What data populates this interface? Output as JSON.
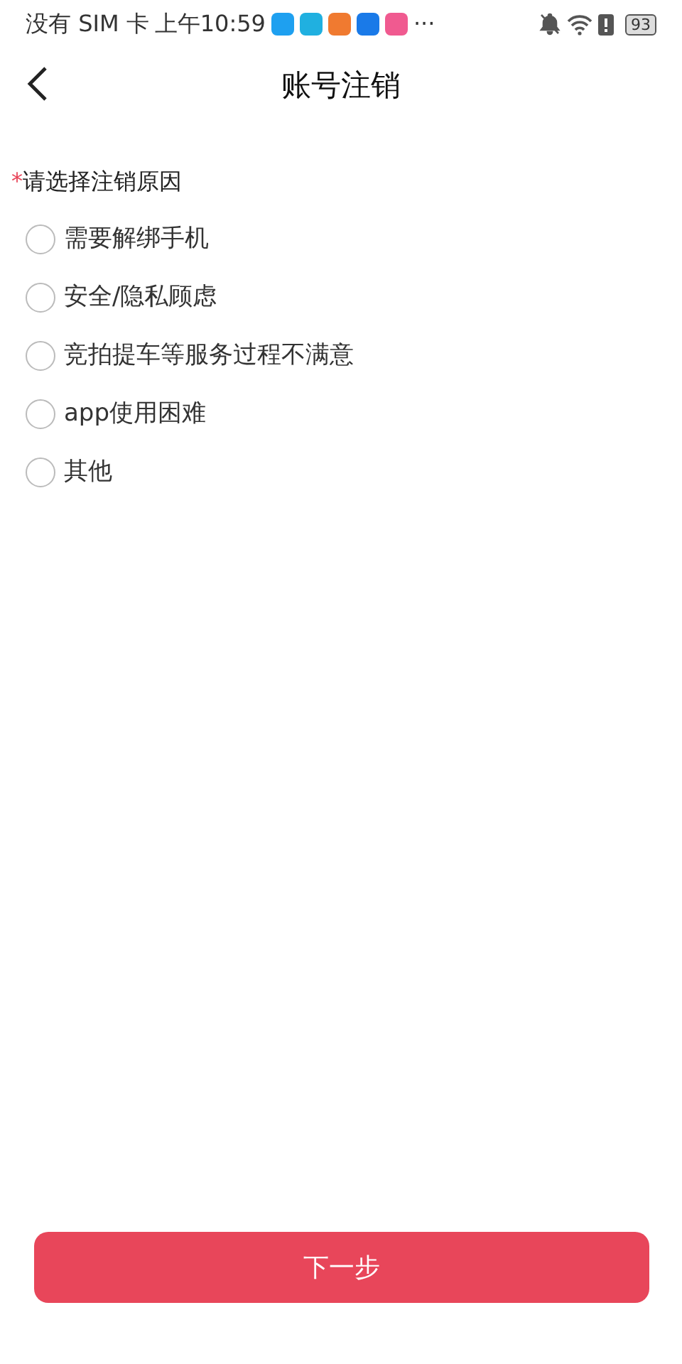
{
  "status_bar": {
    "carrier": "没有 SIM 卡",
    "time": "上午10:59",
    "more": "···",
    "battery": "93"
  },
  "header": {
    "title": "账号注销"
  },
  "form": {
    "required_mark": "*",
    "label": "请选择注销原因",
    "options": [
      {
        "label": "需要解绑手机",
        "selected": false
      },
      {
        "label": "安全/隐私顾虑",
        "selected": false
      },
      {
        "label": "竞拍提车等服务过程不满意",
        "selected": false
      },
      {
        "label": "app使用困难",
        "selected": false
      },
      {
        "label": "其他",
        "selected": false
      }
    ]
  },
  "next_button": "下一步"
}
